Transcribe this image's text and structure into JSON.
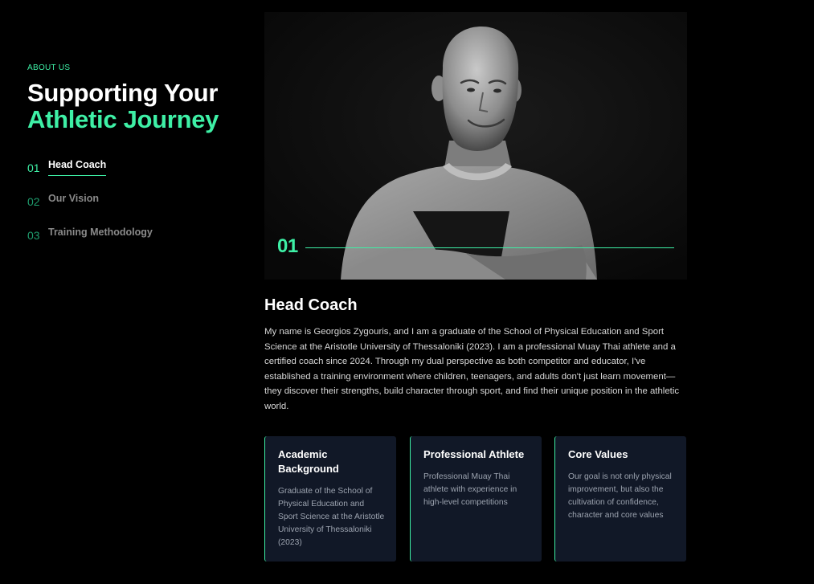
{
  "about": {
    "eyebrow": "ABOUT US",
    "title_line1": "Supporting Your",
    "title_line2": "Athletic Journey"
  },
  "tabs": [
    {
      "number": "01",
      "label": "Head Coach",
      "active": true
    },
    {
      "number": "02",
      "label": "Our Vision",
      "active": false
    },
    {
      "number": "03",
      "label": "Training Methodology",
      "active": false
    }
  ],
  "portrait": {
    "number": "01"
  },
  "content": {
    "heading": "Head Coach",
    "body": "My name is Georgios Zygouris, and I am a graduate of the School of Physical Education and Sport Science at the Aristotle University of Thessaloniki (2023). I am a professional Muay Thai athlete and a certified coach since 2024. Through my dual perspective as both competitor and educator, I've established a training environment where children, teenagers, and adults don't just learn movement—they discover their strengths, build character through sport, and find their unique position in the athletic world."
  },
  "cards": [
    {
      "title": "Academic Background",
      "text": "Graduate of the School of Physical Education and Sport Science at the Aristotle University of Thessaloniki (2023)"
    },
    {
      "title": "Professional Athlete",
      "text": "Professional Muay Thai athlete with experience in high-level competitions"
    },
    {
      "title": "Core Values",
      "text": "Our goal is not only physical improvement, but also the cultivation of confidence, character and core values"
    }
  ],
  "colors": {
    "accent": "#3ef0a6",
    "background": "#000000",
    "card_background": "#111827"
  }
}
